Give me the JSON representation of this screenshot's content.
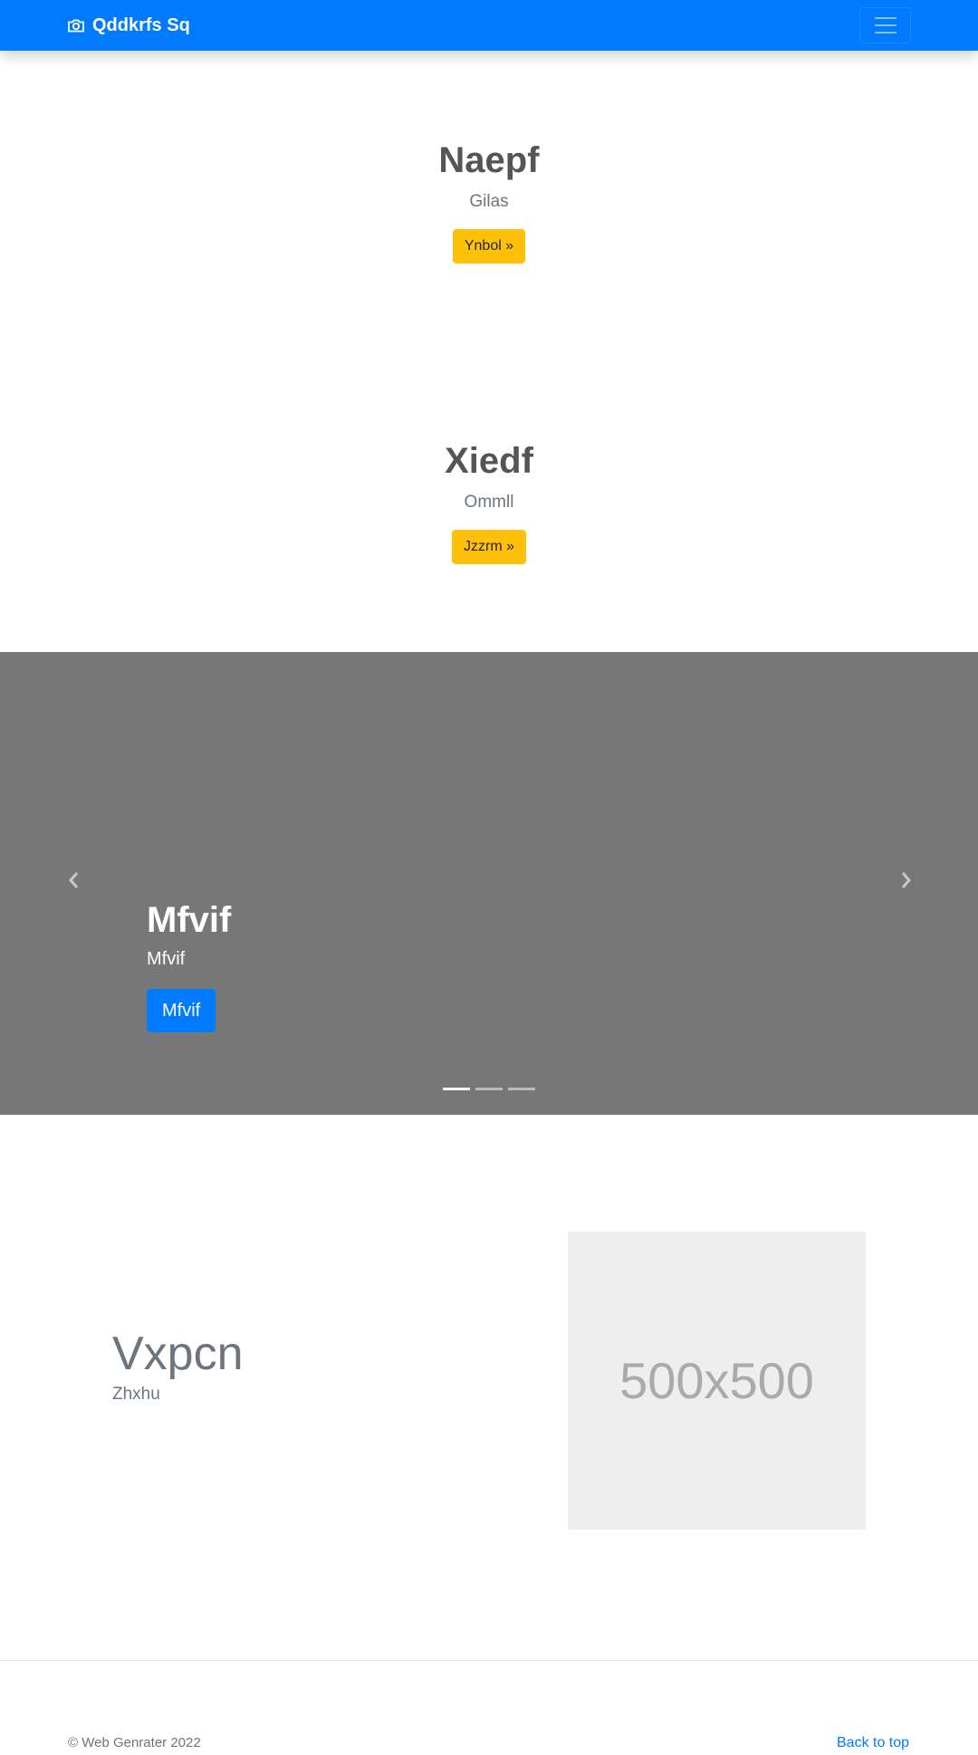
{
  "navbar": {
    "brand": "Qddkrfs Sq",
    "brand_icon": "camera-icon",
    "menu_icon": "hamburger-menu-icon",
    "background": "#007bff"
  },
  "hero_sections": [
    {
      "title": "Naepf",
      "subtitle": "Gilas",
      "button": "Ynbol »"
    },
    {
      "title": "Xiedf",
      "subtitle": "Ommll",
      "button": "Jzzrm »"
    }
  ],
  "carousel": {
    "caption_title": "Mfvif",
    "caption_text": "Mfvif",
    "caption_button": "Mfvif",
    "prev_icon": "chevron-left-icon",
    "next_icon": "chevron-right-icon",
    "indicators": 3,
    "active_index": 0,
    "background": "#777777"
  },
  "feature": {
    "title": "Vxpcn",
    "subtitle": "Zhxhu",
    "image_label": "500x500"
  },
  "footer": {
    "copyright": "© Web Genrater 2022",
    "back_to_top": "Back to top"
  }
}
